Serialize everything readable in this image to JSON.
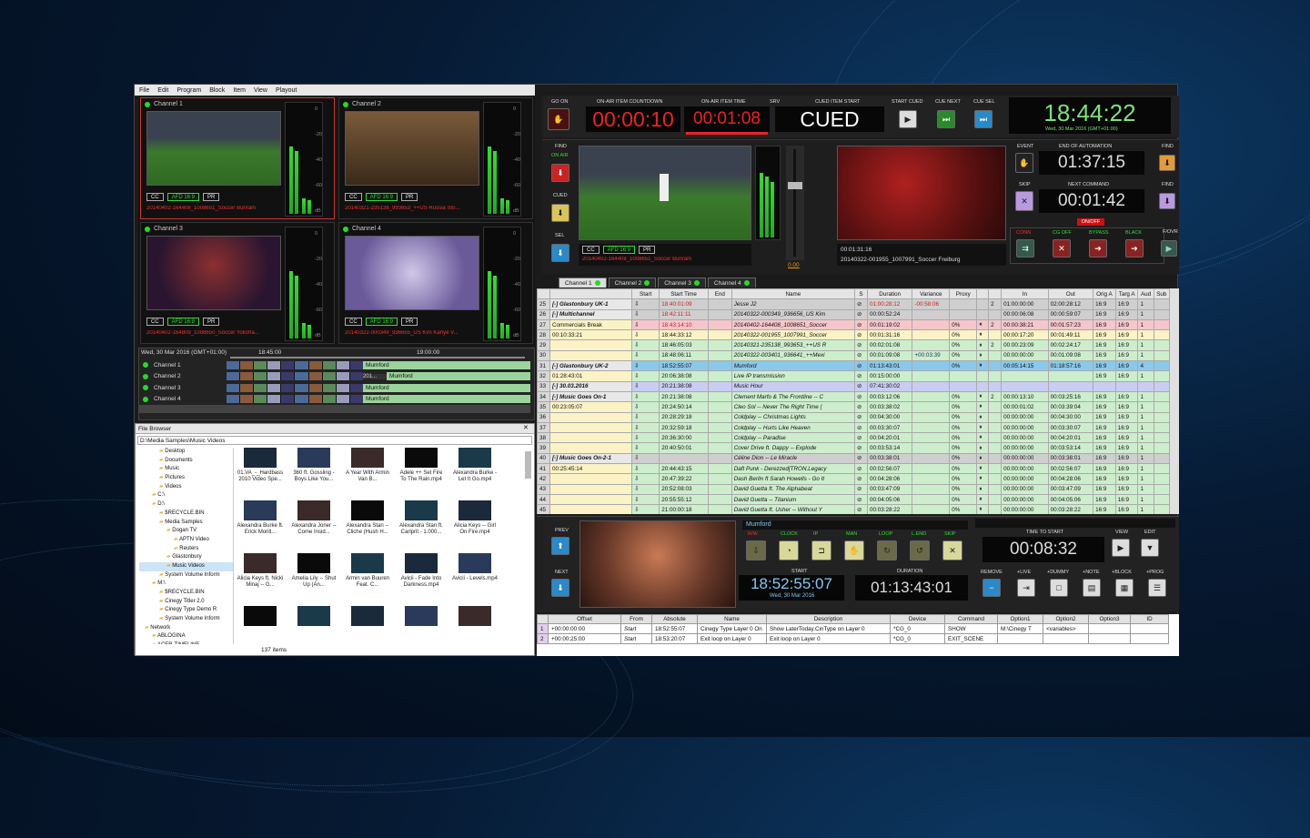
{
  "menu": [
    "File",
    "Edit",
    "Program",
    "Block",
    "Item",
    "View",
    "Playout"
  ],
  "monitors": [
    {
      "name": "Channel 1",
      "clip": "20140402-164408_1008651_Soccer Buriram",
      "tags": [
        "CC",
        "AFD 16:9",
        "PR"
      ]
    },
    {
      "name": "Channel 2",
      "clip": "20140321-235138_993653_++US Russia Sto...",
      "tags": [
        "CC",
        "AFD 16:9",
        "PR"
      ]
    },
    {
      "name": "Channel 3",
      "clip": "20140402-164809_1008650_Soccer Yokoha...",
      "tags": [
        "CC",
        "AFD 16:9",
        "PR"
      ]
    },
    {
      "name": "Channel 4",
      "clip": "20140322-000349_936655_US Kim Kanye V...",
      "tags": [
        "CC",
        "AFD 16:9",
        "PR"
      ]
    }
  ],
  "meter_marks": [
    "0",
    "-20",
    "-40",
    "-60",
    "dB"
  ],
  "timeline": {
    "date": "Wed, 30 Mar 2016 (GMT+01:00)",
    "t1": "18:45:00",
    "t2": "19:00:00",
    "rows": [
      {
        "name": "Channel 1",
        "clip": "Mumford"
      },
      {
        "name": "Channel 2",
        "clip": "Mumford",
        "mid": "201..."
      },
      {
        "name": "Channel 3",
        "clip": "Mumford"
      },
      {
        "name": "Channel 4",
        "clip": "Mumford"
      }
    ],
    "chips": [
      "1",
      "2",
      "3",
      "4"
    ]
  },
  "file_browser": {
    "title": "File Browser",
    "path": "D:\\Media Samples\\Music Videos",
    "tree": [
      "Desktop",
      "Documents",
      "Music",
      "Pictures",
      "Videos",
      "C:\\",
      "D:\\",
      "$RECYCLE.BIN",
      "Media Samples",
      "Dogan TV",
      "APTN Video",
      "Reuters",
      "Glastonbury",
      "Music Videos",
      "System Volume Inform",
      "M:\\",
      "$RECYCLE.BIN",
      "Cinegy Titler 2.0",
      "Cinegy Type Demo R",
      "System Volume Inform",
      "Network",
      "ABLOGINA",
      "ACER-TIMELINE"
    ],
    "files": [
      "01.VA_-_Hardbass 2010 Video Spe...",
      "360 ft. Gossling - Boys Like You...",
      "A Year With Armin Van B...",
      "Adele ++ Set Fire To The Rain.mp4",
      "Alexandra Burke - Let It Go.mp4",
      "Alexandra Burke ft. Erick Morill...",
      "Alexandra Joner -- Come Insid...",
      "Alexandra Stan -- Cliche (Hush H...",
      "Alexandra Stan ft. Carlprit - 1.000...",
      "Alicia Keys -- Girl On Fire.mp4",
      "Alicia Keys ft. Nicki Minaj -- G...",
      "Amelia Lily -- Shut Up (An...",
      "Armin van Buuren Feat. C...",
      "Avicii - Fade Into Darkness.mp4",
      "Avicii - Levels.mp4",
      "",
      "",
      "",
      "",
      ""
    ],
    "count": "137 items"
  },
  "control": {
    "go_on": "GO ON",
    "countdown_label": "ON-AIR ITEM COUNTDOWN",
    "countdown": "00:00:10",
    "itemtime_label": "ON-AIR ITEM TIME",
    "itemtime": "00:01:08",
    "srv": "SRV",
    "cued_label": "CUED ITEM START",
    "cued": "CUED",
    "start_cued": "START CUED",
    "cue_next": "CUE NEXT",
    "cue_sel": "CUE SEL",
    "clock": "18:44:22",
    "clock_date": "Wed, 30 Mar 2016 (GMT+01:00)",
    "find": "FIND",
    "on_air": "ON AIR",
    "sel": "SEL",
    "fader_val": "0.00",
    "preview_time": "00:01:31:16",
    "preview_clip": "20140322-001955_1007991_Soccer Freiburg",
    "event": "EVENT",
    "end_auto_label": "END OF AUTOMATION",
    "end_auto": "01:37:15",
    "skip": "SKIP",
    "next_cmd_label": "NEXT COMMAND",
    "next_cmd": "00:01:42",
    "onoff": "ON/OFF",
    "fovr": "F/OVR",
    "modes": [
      "CONN",
      "CG OFF",
      "BYPASS",
      "BLACK"
    ]
  },
  "channel_tabs": [
    "Channel 1",
    "Channel 2",
    "Channel 3",
    "Channel 4"
  ],
  "playlist": {
    "headers": [
      "",
      "",
      "Start",
      "Start Time",
      "End",
      "Name",
      "S",
      "Duration",
      "Variance",
      "Proxy",
      "",
      "",
      "In",
      "Out",
      "Orig A",
      "Targ A",
      "Aud",
      "Sub"
    ],
    "rows": [
      {
        "n": "25",
        "blk": "[-] Glastonbury UK-1",
        "st": "18:40:01:09",
        "name": "Jesse J2",
        "dur": "01:00:28:12",
        "var": "-00:58:06",
        "proxy": "",
        "a": "2",
        "in": "01:00:00:00",
        "out": "02:00:28:12",
        "oa": "16:9",
        "ta": "16:9",
        "aud": "1",
        "c": "#cfcfcf"
      },
      {
        "n": "26",
        "blk": "[-] Multichannel",
        "st": "18:42:11:11",
        "name": "20140322-000349_936656_US Kim",
        "dur": "00:00:52:24",
        "var": "",
        "proxy": "",
        "a": "",
        "in": "00:00:06:08",
        "out": "00:00:59:07",
        "oa": "16:9",
        "ta": "16:9",
        "aud": "1",
        "c": "#cfcfcf"
      },
      {
        "n": "27",
        "blk": "Commercials Break",
        "st": "18:43:14:10",
        "name": "20140402-164408_1008651_Soccer",
        "dur": "00:01:19:02",
        "var": "",
        "proxy": "0%",
        "a": "2",
        "in": "00:00:38:21",
        "out": "00:01:57:23",
        "oa": "16:9",
        "ta": "16:9",
        "aud": "1",
        "c": "#f5c6cb"
      },
      {
        "n": "28",
        "blk": "00:10:33:21",
        "st": "18:44:33:12",
        "name": "20140322-001955_1007991_Soccer",
        "dur": "00:01:31:16",
        "var": "",
        "proxy": "0%",
        "a": "",
        "in": "00:00:17:20",
        "out": "00:01:49:11",
        "oa": "16:9",
        "ta": "16:9",
        "aud": "1",
        "c": "#fbf3c6"
      },
      {
        "n": "29",
        "blk": "",
        "st": "18:46:05:03",
        "name": "20140321-235138_993653_++US R",
        "dur": "00:02:01:08",
        "var": "",
        "proxy": "0%",
        "a": "2",
        "in": "00:00:23:09",
        "out": "00:02:24:17",
        "oa": "16:9",
        "ta": "16:9",
        "aud": "1",
        "c": "#cdeecd"
      },
      {
        "n": "30",
        "blk": "",
        "st": "18:48:06:11",
        "name": "20140322-003401_936641_++Mexi",
        "dur": "00:01:09:08",
        "var": "+00:03:39",
        "proxy": "0%",
        "a": "",
        "in": "00:00:00:00",
        "out": "00:01:09:08",
        "oa": "16:9",
        "ta": "16:9",
        "aud": "1",
        "c": "#cdeecd"
      },
      {
        "n": "31",
        "blk": "[-] Glastonbury UK-2",
        "st": "18:52:55:07",
        "name": "Mumford",
        "dur": "01:13:43:01",
        "var": "",
        "proxy": "0%",
        "a": "",
        "in": "00:05:14:15",
        "out": "01:18:57:16",
        "oa": "16:9",
        "ta": "16:9",
        "aud": "4",
        "c": "#8ac9ea"
      },
      {
        "n": "32",
        "blk": "01:28:43:01",
        "st": "20:06:38:08",
        "name": "Live IP transmission",
        "dur": "00:15:00:00",
        "var": "",
        "proxy": "",
        "a": "",
        "in": "",
        "out": "",
        "oa": "16:9",
        "ta": "16:9",
        "aud": "1",
        "c": "#cdeecd"
      },
      {
        "n": "33",
        "blk": "[-] 30.03.2016",
        "st": "20:21:38:08",
        "name": "Music Hour",
        "dur": "07:41:30:02",
        "var": "",
        "proxy": "",
        "a": "",
        "in": "",
        "out": "",
        "oa": "",
        "ta": "",
        "aud": "",
        "c": "#c9cdf2"
      },
      {
        "n": "34",
        "blk": "[-] Music Goes On-1",
        "st": "20:21:38:08",
        "name": "Clement Marfo & The Frontline -- C",
        "dur": "00:03:12:06",
        "var": "",
        "proxy": "0%",
        "a": "2",
        "in": "00:00:13:10",
        "out": "00:03:25:16",
        "oa": "16:9",
        "ta": "16:9",
        "aud": "1",
        "c": "#cdeecd"
      },
      {
        "n": "35",
        "blk": "00:23:05:07",
        "st": "20:24:50:14",
        "name": "Cleo Sol -- Never The Right Time (",
        "dur": "00:03:38:02",
        "var": "",
        "proxy": "0%",
        "a": "",
        "in": "00:00:01:02",
        "out": "00:03:39:04",
        "oa": "16:9",
        "ta": "16:9",
        "aud": "1",
        "c": "#cdeecd"
      },
      {
        "n": "36",
        "blk": "",
        "st": "20:28:29:18",
        "name": "Coldplay -- Christmas Lights",
        "dur": "00:04:30:00",
        "var": "",
        "proxy": "0%",
        "a": "",
        "in": "00:00:00:00",
        "out": "00:04:30:00",
        "oa": "16:9",
        "ta": "16:9",
        "aud": "1",
        "c": "#cdeecd"
      },
      {
        "n": "37",
        "blk": "",
        "st": "20:32:59:18",
        "name": "Coldplay -- Hurts Like Heaven",
        "dur": "00:03:30:07",
        "var": "",
        "proxy": "0%",
        "a": "",
        "in": "00:00:00:00",
        "out": "00:03:30:07",
        "oa": "16:9",
        "ta": "16:9",
        "aud": "1",
        "c": "#cdeecd"
      },
      {
        "n": "38",
        "blk": "",
        "st": "20:36:30:00",
        "name": "Coldplay -- Paradise",
        "dur": "00:04:20:01",
        "var": "",
        "proxy": "0%",
        "a": "",
        "in": "00:00:00:00",
        "out": "00:04:20:01",
        "oa": "16:9",
        "ta": "16:9",
        "aud": "1",
        "c": "#cdeecd"
      },
      {
        "n": "39",
        "blk": "",
        "st": "20:40:50:01",
        "name": "Cover Drive ft. Dappy -- Explode",
        "dur": "00:03:53:14",
        "var": "",
        "proxy": "0%",
        "a": "",
        "in": "00:00:00:00",
        "out": "00:03:53:14",
        "oa": "16:9",
        "ta": "16:9",
        "aud": "1",
        "c": "#cdeecd"
      },
      {
        "n": "40",
        "blk": "[-] Music Goes On-2-1",
        "st": "",
        "name": "Céline Dion -- Le Miracle",
        "dur": "00:03:38:01",
        "var": "",
        "proxy": "0%",
        "a": "",
        "in": "00:00:00:00",
        "out": "00:03:38:01",
        "oa": "16:9",
        "ta": "16:9",
        "aud": "1",
        "c": "#cfcfcf"
      },
      {
        "n": "41",
        "blk": "00:25:45:14",
        "st": "20:44:43:15",
        "name": "Daft Punk - Derezzed[TRON.Legacy",
        "dur": "00:02:56:07",
        "var": "",
        "proxy": "0%",
        "a": "",
        "in": "00:00:00:00",
        "out": "00:02:56:07",
        "oa": "16:9",
        "ta": "16:9",
        "aud": "1",
        "c": "#cdeecd"
      },
      {
        "n": "42",
        "blk": "",
        "st": "20:47:39:22",
        "name": "Dash Berlin ft Sarah Howells - Go It",
        "dur": "00:04:28:06",
        "var": "",
        "proxy": "0%",
        "a": "",
        "in": "00:00:00:00",
        "out": "00:04:28:06",
        "oa": "16:9",
        "ta": "16:9",
        "aud": "1",
        "c": "#cdeecd"
      },
      {
        "n": "43",
        "blk": "",
        "st": "20:52:08:03",
        "name": "David Guetta ft. The Alphabeat",
        "dur": "00:03:47:09",
        "var": "",
        "proxy": "0%",
        "a": "",
        "in": "00:00:00:00",
        "out": "00:03:47:09",
        "oa": "16:9",
        "ta": "16:9",
        "aud": "1",
        "c": "#cdeecd"
      },
      {
        "n": "44",
        "blk": "",
        "st": "20:55:55:12",
        "name": "David Guetta -- Titanium",
        "dur": "00:04:05:06",
        "var": "",
        "proxy": "0%",
        "a": "",
        "in": "00:00:00:00",
        "out": "00:04:05:06",
        "oa": "16:9",
        "ta": "16:9",
        "aud": "1",
        "c": "#cdeecd"
      },
      {
        "n": "45",
        "blk": "",
        "st": "21:00:00:18",
        "name": "David Guetta ft. Usher -- Without Y",
        "dur": "00:03:28:22",
        "var": "",
        "proxy": "0%",
        "a": "",
        "in": "00:00:00:00",
        "out": "00:03:28:22",
        "oa": "16:9",
        "ta": "16:9",
        "aud": "1",
        "c": "#cdeecd"
      }
    ]
  },
  "item": {
    "prev": "PREV",
    "next": "NEXT",
    "name": "Mumford",
    "flags": [
      "R/W",
      "CLOCK",
      "IP",
      "MAN",
      "LOOP",
      "L.END",
      "SKIP"
    ],
    "start_label": "START",
    "start": "18:52:55:07",
    "start_date": "Wed, 30 Mar 2016",
    "duration_label": "DURATION",
    "duration": "01:13:43:01",
    "tts_label": "TIME TO START",
    "tts": "00:08:32",
    "view": "VIEW",
    "edit": "EDIT",
    "remove": "REMOVE",
    "live": "+LIVE",
    "dummy": "+DUMMY",
    "note": "+NOTE",
    "block": "+BLOCK",
    "prog": "+PROG"
  },
  "events": {
    "headers": [
      "",
      "Offset",
      "From",
      "Absolute",
      "Name",
      "Description",
      "Device",
      "Command",
      "Option1",
      "Option2",
      "Option3",
      "ID"
    ],
    "rows": [
      {
        "n": "1",
        "offset": "+00:00:00:00",
        "from": "Start",
        "abs": "18:52:55:07",
        "name": "Cinegy Type Layer 0 On",
        "desc": "Show LaterToday.CinType on Layer 0",
        "dev": "*CG_0",
        "cmd": "SHOW",
        "o1": "M:\\Cinegy T",
        "o2": "<variables>",
        "o3": "",
        "id": ""
      },
      {
        "n": "2",
        "offset": "+00:00:25:00",
        "from": "Start",
        "abs": "18:53:20:07",
        "name": "Exit loop on Layer 0",
        "desc": "Exit loop on Layer 0",
        "dev": "*CG_0",
        "cmd": "EXIT_SCENE",
        "o1": "",
        "o2": "",
        "o3": "",
        "id": ""
      }
    ]
  },
  "colors": {
    "accent_red": "#e03030",
    "accent_green": "#2ee02e",
    "clock_green": "#7fe07f",
    "selected_blue": "#8ac9ea"
  }
}
